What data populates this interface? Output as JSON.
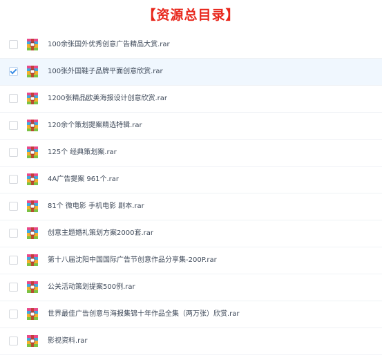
{
  "page": {
    "title": "【资源总目录】",
    "title_color": "#e8261b"
  },
  "file_icon": "archive-rar-icon",
  "files": [
    {
      "name": "100余张国外优秀创意广告精品大赏.rar",
      "checked": false
    },
    {
      "name": "100张外国鞋子品牌平面创意欣赏.rar",
      "checked": true
    },
    {
      "name": "1200张精品欧美海报设计创意欣赏.rar",
      "checked": false
    },
    {
      "name": "120余个策划提案精选特辑.rar",
      "checked": false
    },
    {
      "name": "125个 经典策划案.rar",
      "checked": false
    },
    {
      "name": "4A广告提案 961个.rar",
      "checked": false
    },
    {
      "name": "81个 微电影 手机电影 剧本.rar",
      "checked": false
    },
    {
      "name": "创意主题婚礼策划方案2000套.rar",
      "checked": false
    },
    {
      "name": "第十八届沈阳中国国际广告节创意作品分享集-200P.rar",
      "checked": false
    },
    {
      "name": "公关活动策划提案500例.rar",
      "checked": false
    },
    {
      "name": "世界最佳广告创意与海报集锦十年作品全集（两万张）欣赏.rar",
      "checked": false
    },
    {
      "name": "影视资料.rar",
      "checked": false
    }
  ]
}
